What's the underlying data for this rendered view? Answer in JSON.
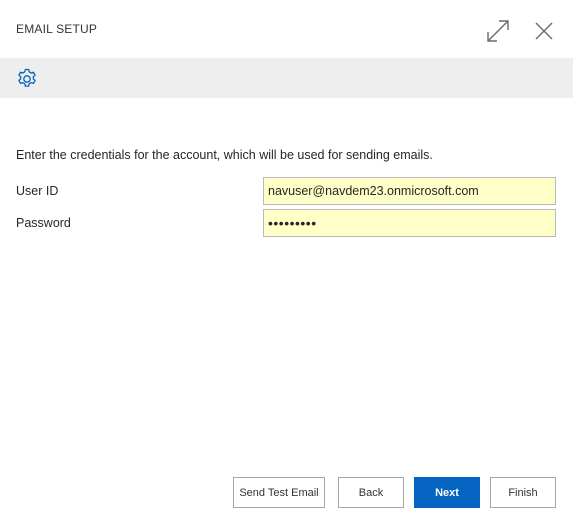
{
  "dialog": {
    "title": "EMAIL SETUP",
    "icons": {
      "expand": "expand-icon",
      "close": "close-icon",
      "settings": "gear-icon"
    }
  },
  "form": {
    "instructions": "Enter the credentials for the account, which will be used for sending emails.",
    "user_id": {
      "label": "User ID",
      "value": "navuser@navdem23.onmicrosoft.com"
    },
    "password": {
      "label": "Password",
      "value": "•••••••••"
    }
  },
  "buttons": {
    "send_test": "Send Test Email",
    "back": "Back",
    "next": "Next",
    "finish": "Finish"
  },
  "colors": {
    "accent": "#0563c1",
    "input_background": "#ffffc8",
    "action_bar": "#eeeeee"
  }
}
